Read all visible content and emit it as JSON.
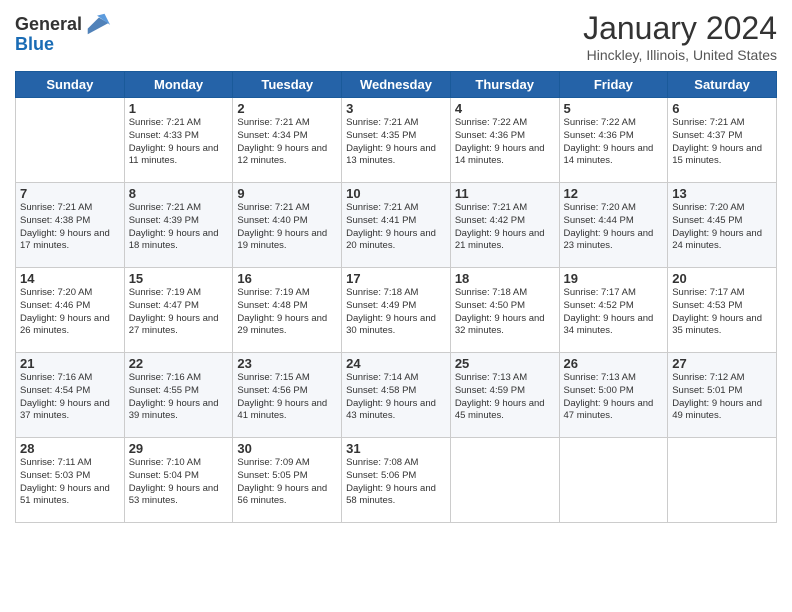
{
  "header": {
    "logo_general": "General",
    "logo_blue": "Blue",
    "month_title": "January 2024",
    "location": "Hinckley, Illinois, United States"
  },
  "days_of_week": [
    "Sunday",
    "Monday",
    "Tuesday",
    "Wednesday",
    "Thursday",
    "Friday",
    "Saturday"
  ],
  "weeks": [
    [
      {
        "day": "",
        "sunrise": "",
        "sunset": "",
        "daylight": ""
      },
      {
        "day": "1",
        "sunrise": "Sunrise: 7:21 AM",
        "sunset": "Sunset: 4:33 PM",
        "daylight": "Daylight: 9 hours and 11 minutes."
      },
      {
        "day": "2",
        "sunrise": "Sunrise: 7:21 AM",
        "sunset": "Sunset: 4:34 PM",
        "daylight": "Daylight: 9 hours and 12 minutes."
      },
      {
        "day": "3",
        "sunrise": "Sunrise: 7:21 AM",
        "sunset": "Sunset: 4:35 PM",
        "daylight": "Daylight: 9 hours and 13 minutes."
      },
      {
        "day": "4",
        "sunrise": "Sunrise: 7:22 AM",
        "sunset": "Sunset: 4:36 PM",
        "daylight": "Daylight: 9 hours and 14 minutes."
      },
      {
        "day": "5",
        "sunrise": "Sunrise: 7:22 AM",
        "sunset": "Sunset: 4:36 PM",
        "daylight": "Daylight: 9 hours and 14 minutes."
      },
      {
        "day": "6",
        "sunrise": "Sunrise: 7:21 AM",
        "sunset": "Sunset: 4:37 PM",
        "daylight": "Daylight: 9 hours and 15 minutes."
      }
    ],
    [
      {
        "day": "7",
        "sunrise": "Sunrise: 7:21 AM",
        "sunset": "Sunset: 4:38 PM",
        "daylight": "Daylight: 9 hours and 17 minutes."
      },
      {
        "day": "8",
        "sunrise": "Sunrise: 7:21 AM",
        "sunset": "Sunset: 4:39 PM",
        "daylight": "Daylight: 9 hours and 18 minutes."
      },
      {
        "day": "9",
        "sunrise": "Sunrise: 7:21 AM",
        "sunset": "Sunset: 4:40 PM",
        "daylight": "Daylight: 9 hours and 19 minutes."
      },
      {
        "day": "10",
        "sunrise": "Sunrise: 7:21 AM",
        "sunset": "Sunset: 4:41 PM",
        "daylight": "Daylight: 9 hours and 20 minutes."
      },
      {
        "day": "11",
        "sunrise": "Sunrise: 7:21 AM",
        "sunset": "Sunset: 4:42 PM",
        "daylight": "Daylight: 9 hours and 21 minutes."
      },
      {
        "day": "12",
        "sunrise": "Sunrise: 7:20 AM",
        "sunset": "Sunset: 4:44 PM",
        "daylight": "Daylight: 9 hours and 23 minutes."
      },
      {
        "day": "13",
        "sunrise": "Sunrise: 7:20 AM",
        "sunset": "Sunset: 4:45 PM",
        "daylight": "Daylight: 9 hours and 24 minutes."
      }
    ],
    [
      {
        "day": "14",
        "sunrise": "Sunrise: 7:20 AM",
        "sunset": "Sunset: 4:46 PM",
        "daylight": "Daylight: 9 hours and 26 minutes."
      },
      {
        "day": "15",
        "sunrise": "Sunrise: 7:19 AM",
        "sunset": "Sunset: 4:47 PM",
        "daylight": "Daylight: 9 hours and 27 minutes."
      },
      {
        "day": "16",
        "sunrise": "Sunrise: 7:19 AM",
        "sunset": "Sunset: 4:48 PM",
        "daylight": "Daylight: 9 hours and 29 minutes."
      },
      {
        "day": "17",
        "sunrise": "Sunrise: 7:18 AM",
        "sunset": "Sunset: 4:49 PM",
        "daylight": "Daylight: 9 hours and 30 minutes."
      },
      {
        "day": "18",
        "sunrise": "Sunrise: 7:18 AM",
        "sunset": "Sunset: 4:50 PM",
        "daylight": "Daylight: 9 hours and 32 minutes."
      },
      {
        "day": "19",
        "sunrise": "Sunrise: 7:17 AM",
        "sunset": "Sunset: 4:52 PM",
        "daylight": "Daylight: 9 hours and 34 minutes."
      },
      {
        "day": "20",
        "sunrise": "Sunrise: 7:17 AM",
        "sunset": "Sunset: 4:53 PM",
        "daylight": "Daylight: 9 hours and 35 minutes."
      }
    ],
    [
      {
        "day": "21",
        "sunrise": "Sunrise: 7:16 AM",
        "sunset": "Sunset: 4:54 PM",
        "daylight": "Daylight: 9 hours and 37 minutes."
      },
      {
        "day": "22",
        "sunrise": "Sunrise: 7:16 AM",
        "sunset": "Sunset: 4:55 PM",
        "daylight": "Daylight: 9 hours and 39 minutes."
      },
      {
        "day": "23",
        "sunrise": "Sunrise: 7:15 AM",
        "sunset": "Sunset: 4:56 PM",
        "daylight": "Daylight: 9 hours and 41 minutes."
      },
      {
        "day": "24",
        "sunrise": "Sunrise: 7:14 AM",
        "sunset": "Sunset: 4:58 PM",
        "daylight": "Daylight: 9 hours and 43 minutes."
      },
      {
        "day": "25",
        "sunrise": "Sunrise: 7:13 AM",
        "sunset": "Sunset: 4:59 PM",
        "daylight": "Daylight: 9 hours and 45 minutes."
      },
      {
        "day": "26",
        "sunrise": "Sunrise: 7:13 AM",
        "sunset": "Sunset: 5:00 PM",
        "daylight": "Daylight: 9 hours and 47 minutes."
      },
      {
        "day": "27",
        "sunrise": "Sunrise: 7:12 AM",
        "sunset": "Sunset: 5:01 PM",
        "daylight": "Daylight: 9 hours and 49 minutes."
      }
    ],
    [
      {
        "day": "28",
        "sunrise": "Sunrise: 7:11 AM",
        "sunset": "Sunset: 5:03 PM",
        "daylight": "Daylight: 9 hours and 51 minutes."
      },
      {
        "day": "29",
        "sunrise": "Sunrise: 7:10 AM",
        "sunset": "Sunset: 5:04 PM",
        "daylight": "Daylight: 9 hours and 53 minutes."
      },
      {
        "day": "30",
        "sunrise": "Sunrise: 7:09 AM",
        "sunset": "Sunset: 5:05 PM",
        "daylight": "Daylight: 9 hours and 56 minutes."
      },
      {
        "day": "31",
        "sunrise": "Sunrise: 7:08 AM",
        "sunset": "Sunset: 5:06 PM",
        "daylight": "Daylight: 9 hours and 58 minutes."
      },
      {
        "day": "",
        "sunrise": "",
        "sunset": "",
        "daylight": ""
      },
      {
        "day": "",
        "sunrise": "",
        "sunset": "",
        "daylight": ""
      },
      {
        "day": "",
        "sunrise": "",
        "sunset": "",
        "daylight": ""
      }
    ]
  ]
}
